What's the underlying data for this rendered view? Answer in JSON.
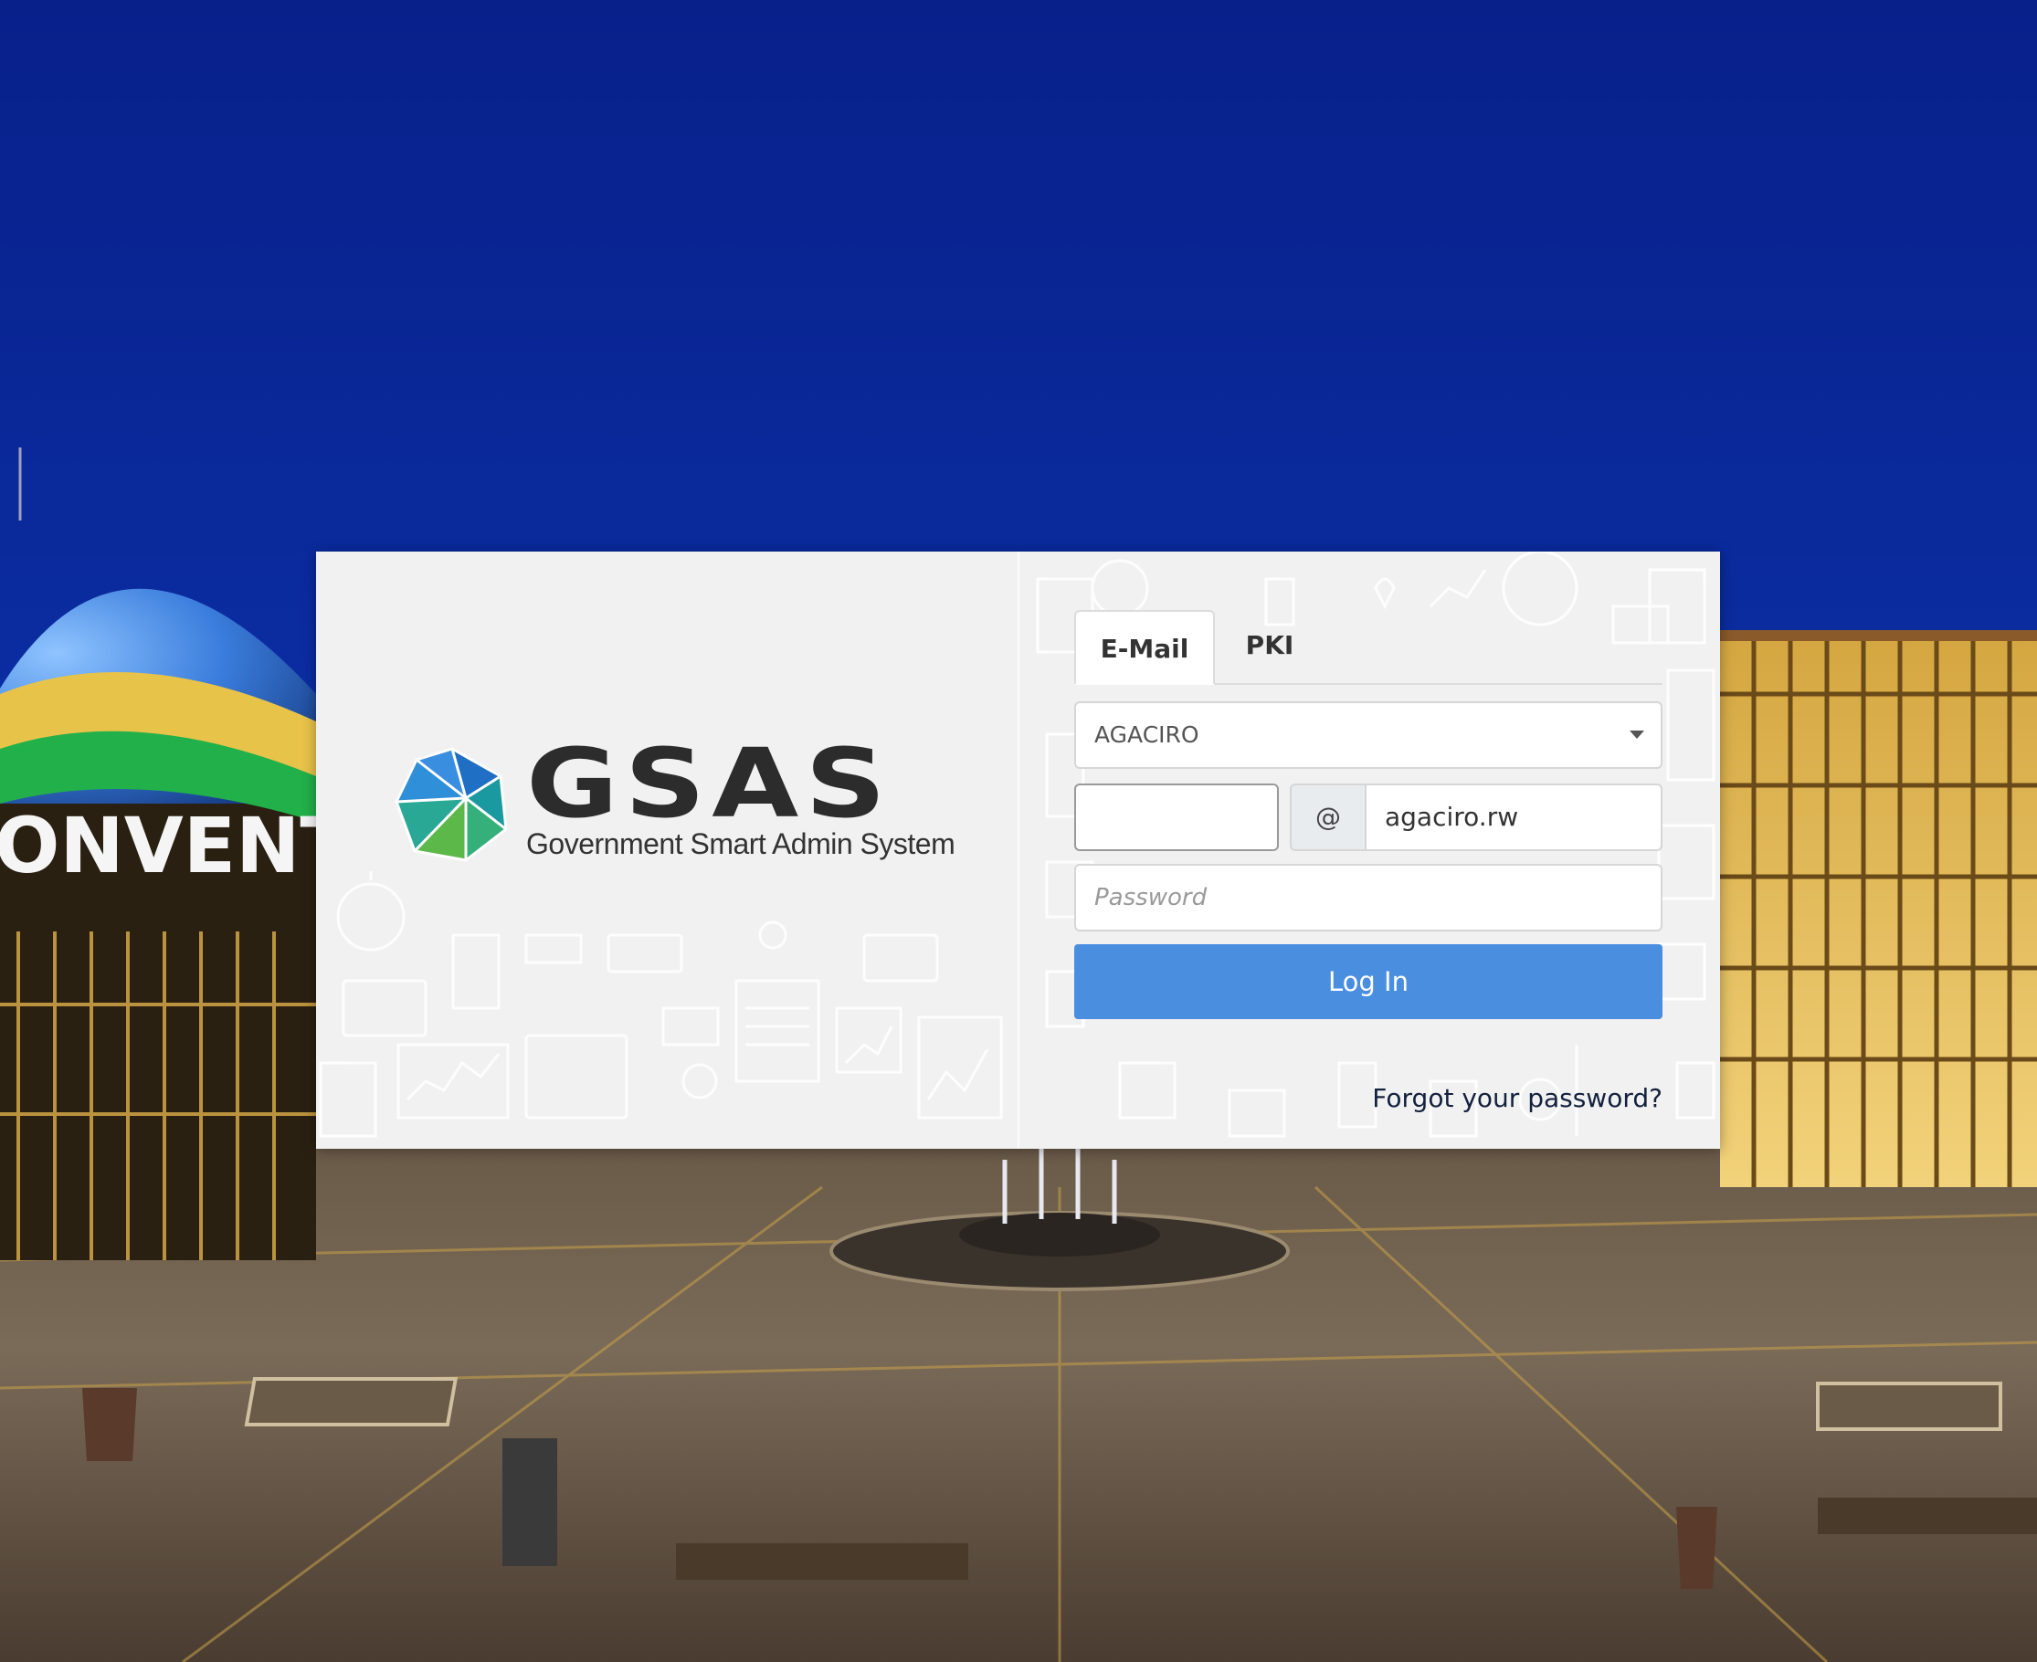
{
  "brand": {
    "name": "GSAS",
    "tagline": "Government Smart Admin System",
    "colors": {
      "blue": "#2f7fd4",
      "teal": "#1aa39a",
      "green": "#5cb848"
    }
  },
  "background": {
    "sign_text": "ONVENT",
    "sky_color": "#0c2d9c"
  },
  "login": {
    "tabs": [
      {
        "label": "E-Mail",
        "active": true
      },
      {
        "label": "PKI",
        "active": false
      }
    ],
    "organization_select": {
      "value": "AGACIRO"
    },
    "username": {
      "value": "",
      "placeholder": ""
    },
    "at_symbol": "@",
    "domain": {
      "value": "agaciro.rw"
    },
    "password": {
      "placeholder": "Password"
    },
    "submit_label": "Log In",
    "forgot_label": "Forgot your password?",
    "accent_color": "#4a8ee0"
  }
}
